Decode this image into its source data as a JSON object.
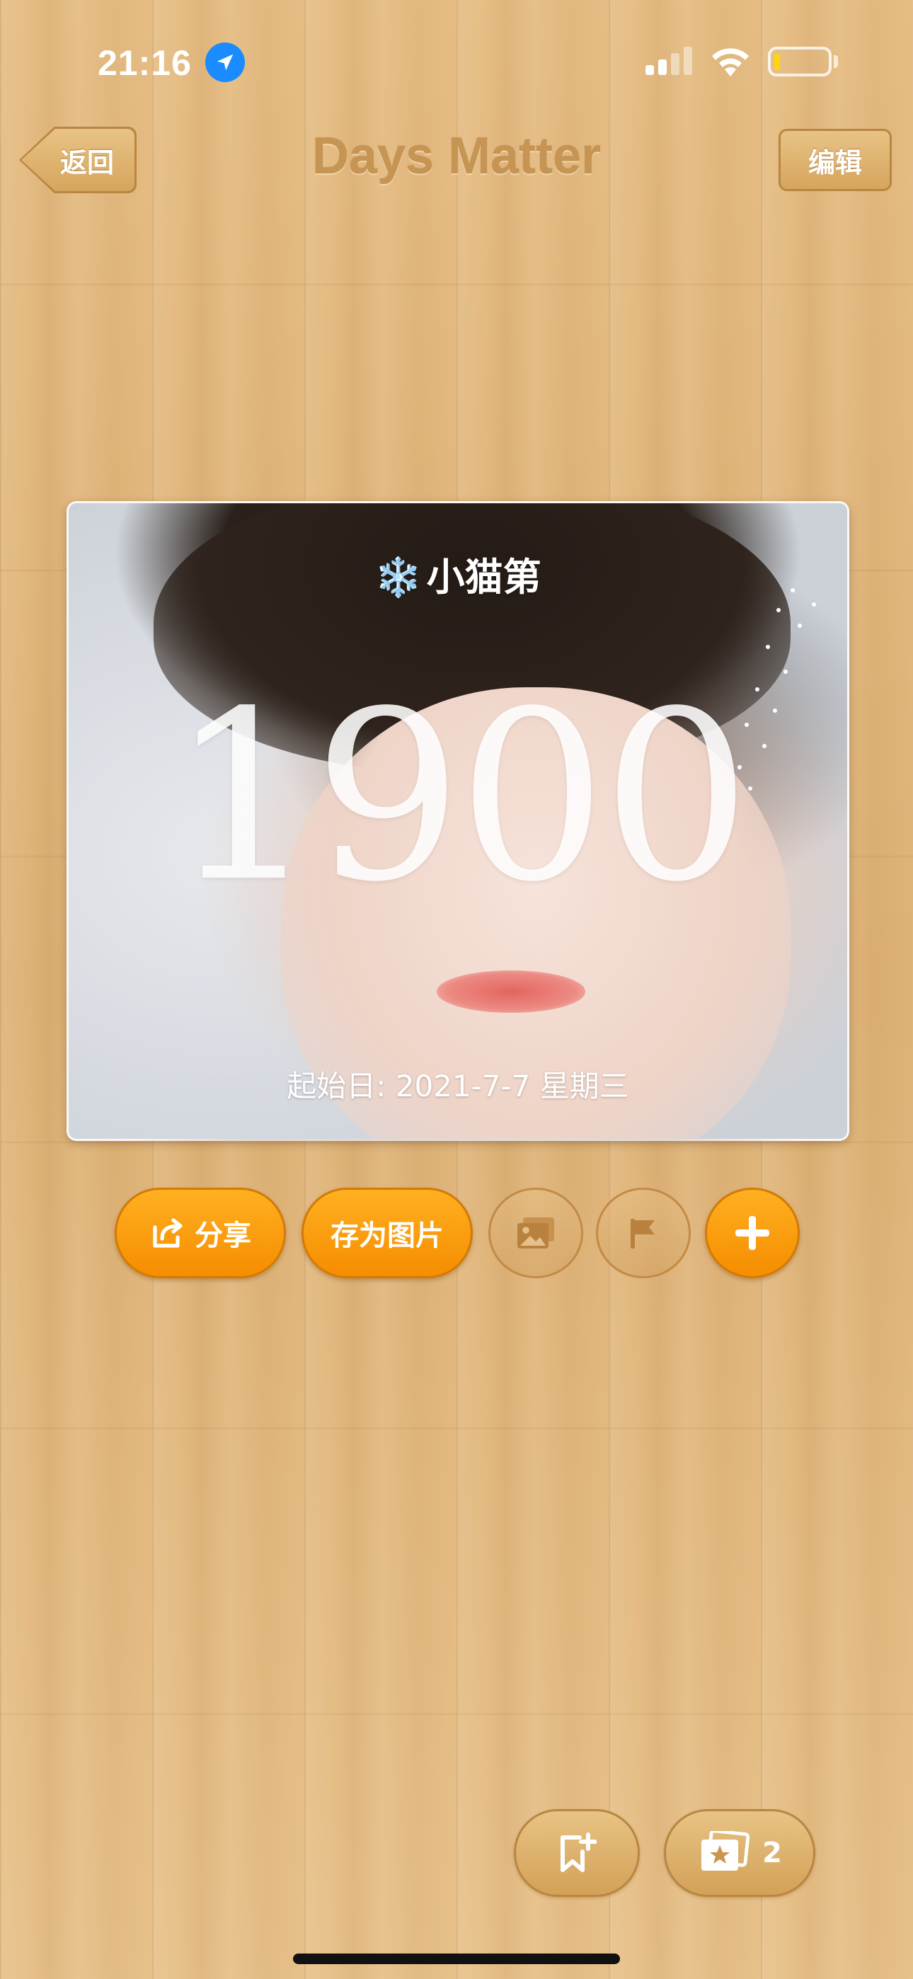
{
  "status_bar": {
    "time": "21:16",
    "battery_level": 0.1,
    "icons": [
      "location-arrow-icon",
      "cellular-signal-icon",
      "wifi-icon",
      "battery-icon"
    ]
  },
  "nav": {
    "back_label": "返回",
    "title": "Days Matter",
    "edit_label": "编辑"
  },
  "card": {
    "title": "小猫第",
    "title_icon": "❄️",
    "day_count": "1900",
    "start_date": "起始日: 2021-7-7 星期三"
  },
  "actions": {
    "share_label": "分享",
    "save_image_label": "存为图片",
    "icons": [
      "share-icon",
      "image-icon",
      "flag-icon",
      "plus-icon"
    ]
  },
  "bottom": {
    "gallery_count": "2",
    "icons": [
      "bookmark-add-icon",
      "photo-stack-star-icon"
    ]
  },
  "colors": {
    "accent_orange": "#f89a0c",
    "wood": "#e3b77a",
    "title_brown": "#c69553",
    "location_blue": "#1a8cff",
    "battery_yellow": "#ffd60a"
  }
}
